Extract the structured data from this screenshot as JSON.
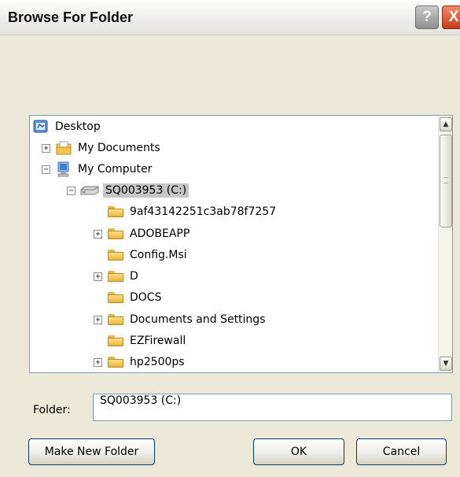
{
  "window": {
    "title": "Browse For Folder",
    "help_glyph": "?",
    "close_glyph": "X"
  },
  "tree": {
    "items": [
      {
        "label": "Desktop",
        "icon": "desktop-icon",
        "expander": ""
      },
      {
        "label": "My Documents",
        "icon": "my-documents-icon",
        "expander": "+"
      },
      {
        "label": "My Computer",
        "icon": "my-computer-icon",
        "expander": "−"
      },
      {
        "label": "SQ003953 (C:)",
        "icon": "drive-icon",
        "expander": "−",
        "selected": true
      },
      {
        "label": "9af43142251c3ab78f7257",
        "icon": "folder-icon",
        "expander": ""
      },
      {
        "label": "ADOBEAPP",
        "icon": "folder-icon",
        "expander": "+"
      },
      {
        "label": "Config.Msi",
        "icon": "folder-icon",
        "expander": ""
      },
      {
        "label": "D",
        "icon": "folder-icon",
        "expander": "+"
      },
      {
        "label": "DOCS",
        "icon": "folder-icon",
        "expander": ""
      },
      {
        "label": "Documents and Settings",
        "icon": "folder-icon",
        "expander": "+"
      },
      {
        "label": "EZFirewall",
        "icon": "folder-icon",
        "expander": ""
      },
      {
        "label": "hp2500ps",
        "icon": "folder-icon",
        "expander": "+"
      }
    ]
  },
  "scrollbar": {
    "up_glyph": "▲",
    "down_glyph": "▼"
  },
  "folder_field": {
    "label": "Folder:",
    "value": "SQ003953 (C:)"
  },
  "buttons": {
    "make_new_folder": "Make New Folder",
    "ok": "OK",
    "cancel": "Cancel"
  }
}
